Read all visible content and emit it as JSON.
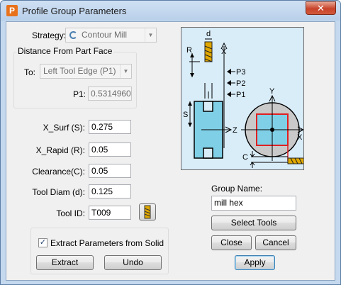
{
  "window": {
    "title": "Profile Group Parameters",
    "close_glyph": "✕",
    "app_icon_letter": "P"
  },
  "strategy": {
    "label": "Strategy:",
    "value": "Contour Mill"
  },
  "distance_group": {
    "title": "Distance From Part Face",
    "to_label": "To:",
    "to_value": "Left Tool Edge (P1)",
    "p1_label": "P1:",
    "p1_value": "0.53149606"
  },
  "params": {
    "x_surf_label": "X_Surf (S):",
    "x_surf_value": "0.275",
    "x_rapid_label": "X_Rapid (R):",
    "x_rapid_value": "0.05",
    "clearance_label": "Clearance(C):",
    "clearance_value": "0.05",
    "tool_diam_label": "Tool Diam (d):",
    "tool_diam_value": "0.125",
    "tool_id_label": "Tool ID:",
    "tool_id_value": "T009"
  },
  "extract_group": {
    "checkbox_label": "Extract Parameters from Solid",
    "checked": true,
    "extract_label": "Extract",
    "undo_label": "Undo"
  },
  "group_name": {
    "label": "Group Name:",
    "value": "mill hex"
  },
  "buttons": {
    "select_tools": "Select Tools",
    "close": "Close",
    "cancel": "Cancel",
    "apply": "Apply"
  },
  "diagram": {
    "labels": {
      "d": "d",
      "r": "R",
      "x_top": "X",
      "p3": "P3",
      "p2": "P2",
      "p1": "P1",
      "s": "S",
      "z": "Z",
      "y": "Y",
      "x_right": "X",
      "c": "C"
    },
    "colors": {
      "background": "#d9edf9",
      "part": "#7fcfe6",
      "accent": "#e02020",
      "tool": "#e0a800"
    }
  }
}
